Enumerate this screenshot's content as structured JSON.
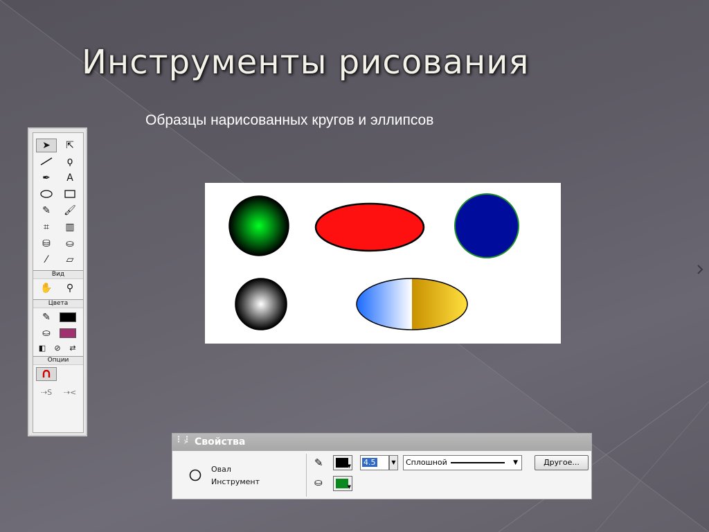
{
  "slide": {
    "title": "Инструменты рисования",
    "subtitle": "Образцы нарисованных кругов и эллипсов"
  },
  "toolbox": {
    "sections": {
      "view": "Вид",
      "colors": "Цвета",
      "options": "Опции"
    },
    "tools": [
      "arrow-icon",
      "subselect-icon",
      "line-icon",
      "lasso-icon",
      "pen-icon",
      "text-icon",
      "oval-icon",
      "rectangle-icon",
      "pencil-icon",
      "brush-icon",
      "free-transform-icon",
      "fill-transform-icon",
      "ink-bottle-icon",
      "paint-bucket-icon",
      "eyedropper-icon",
      "eraser-icon",
      "hand-icon",
      "zoom-icon"
    ],
    "stroke_color": "#000000",
    "fill_color": "#a0306e"
  },
  "canvas": {
    "shapes": [
      {
        "name": "green-radial-circle",
        "colors": [
          "#00ff22",
          "#000000"
        ]
      },
      {
        "name": "red-ellipse",
        "colors": [
          "#ff1010",
          "#000000"
        ]
      },
      {
        "name": "blue-circle",
        "colors": [
          "#000c9c",
          "#1c8c2c"
        ]
      },
      {
        "name": "gray-radial-circle",
        "colors": [
          "#ffffff",
          "#000000"
        ]
      },
      {
        "name": "blue-white-gold-ellipse",
        "colors": [
          "#1a6aff",
          "#ffffff",
          "#c89000",
          "#ffe040"
        ]
      }
    ]
  },
  "properties": {
    "header": "Свойства",
    "shape_name": "Овал",
    "shape_type": "Инструмент",
    "stroke_color": "#000000",
    "fill_color": "#0a8a1e",
    "stroke_width": "4.5",
    "stroke_style": "Сплошной",
    "custom_button": "Другое..."
  }
}
